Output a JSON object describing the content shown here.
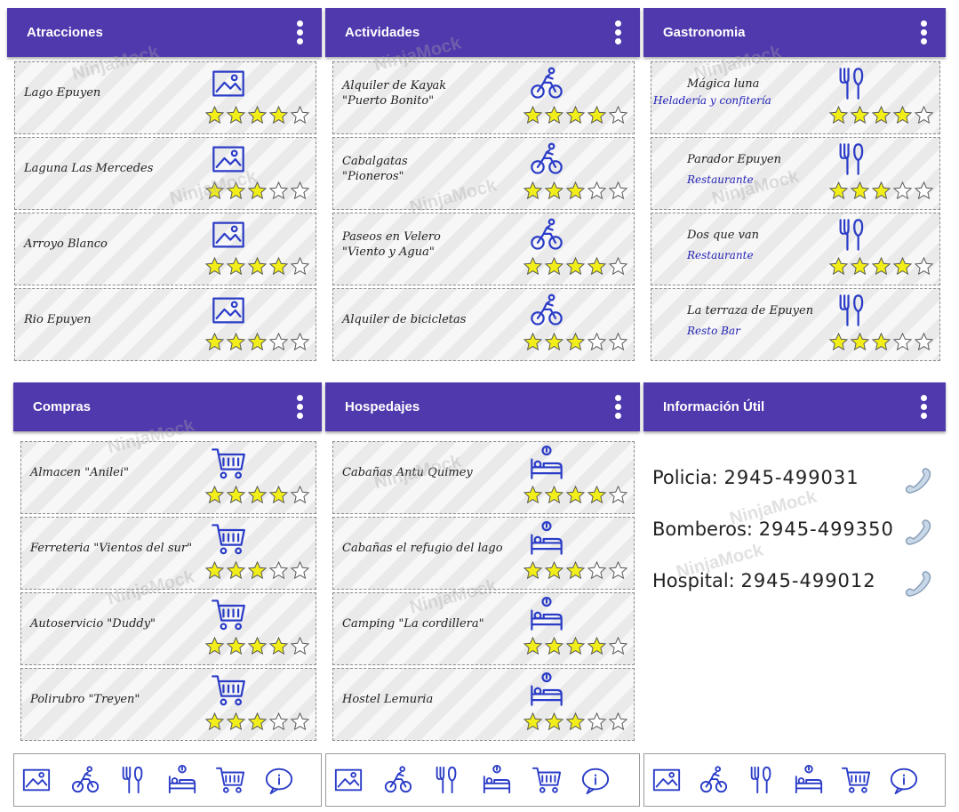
{
  "panels": [
    {
      "title": "Atracciones",
      "items": [
        {
          "name": "Lago Epuyen",
          "sub": "",
          "icon": "image",
          "rating": 4
        },
        {
          "name": "Laguna Las Mercedes",
          "sub": "",
          "icon": "image",
          "rating": 3
        },
        {
          "name": "Arroyo Blanco",
          "sub": "",
          "icon": "image",
          "rating": 4
        },
        {
          "name": "Rio Epuyen",
          "sub": "",
          "icon": "image",
          "rating": 3
        }
      ]
    },
    {
      "title": "Actividades",
      "items": [
        {
          "name": "Alquiler de Kayak\n\"Puerto Bonito\"",
          "sub": "",
          "icon": "bike",
          "rating": 4
        },
        {
          "name": "Cabalgatas\n\"Pioneros\"",
          "sub": "",
          "icon": "bike",
          "rating": 3
        },
        {
          "name": "Paseos en Velero\n\"Viento y Agua\"",
          "sub": "",
          "icon": "bike",
          "rating": 4
        },
        {
          "name": "Alquiler de bicicletas",
          "sub": "",
          "icon": "bike",
          "rating": 3
        }
      ]
    },
    {
      "title": "Gastronomia",
      "items": [
        {
          "name": "Mágica luna",
          "sub": "Heladería y confitería",
          "icon": "cutlery",
          "rating": 4
        },
        {
          "name": "Parador Epuyen",
          "sub": "Restaurante",
          "icon": "cutlery",
          "rating": 3
        },
        {
          "name": "Dos que van",
          "sub": "Restaurante",
          "icon": "cutlery",
          "rating": 4
        },
        {
          "name": "La terraza de Epuyen",
          "sub": "Resto Bar",
          "icon": "cutlery",
          "rating": 3
        }
      ]
    },
    {
      "title": "Compras",
      "items": [
        {
          "name": "Almacen \"Anilei\"",
          "sub": "",
          "icon": "cart",
          "rating": 4
        },
        {
          "name": "Ferreteria \"Vientos del sur\"",
          "sub": "",
          "icon": "cart",
          "rating": 3
        },
        {
          "name": "Autoservicio \"Duddy\"",
          "sub": "",
          "icon": "cart",
          "rating": 4
        },
        {
          "name": "Polirubro \"Treyen\"",
          "sub": "",
          "icon": "cart",
          "rating": 3
        }
      ]
    },
    {
      "title": "Hospedajes",
      "items": [
        {
          "name": "Cabañas Antu Quimey",
          "sub": "",
          "icon": "bed",
          "rating": 4
        },
        {
          "name": "Cabañas el refugio del lago",
          "sub": "",
          "icon": "bed",
          "rating": 3
        },
        {
          "name": "Camping \"La cordillera\"",
          "sub": "",
          "icon": "bed",
          "rating": 4
        },
        {
          "name": "Hostel Lemuria",
          "sub": "",
          "icon": "bed",
          "rating": 3
        }
      ]
    },
    {
      "title": "Información Útil",
      "phones": [
        {
          "label": "Policia:",
          "number": "2945-499031"
        },
        {
          "label": "Bomberos:",
          "number": "2945-499350"
        },
        {
          "label": "Hospital:",
          "number": "2945-499012"
        }
      ]
    }
  ],
  "navbar_icons": [
    "image-icon",
    "bike-icon",
    "cutlery-icon",
    "bed-icon",
    "cart-icon",
    "info-icon"
  ],
  "colors": {
    "appbar": "#5038ad",
    "icon": "#2a3cc7",
    "star": "#f2ee1a"
  },
  "watermark": "NinjaMock"
}
